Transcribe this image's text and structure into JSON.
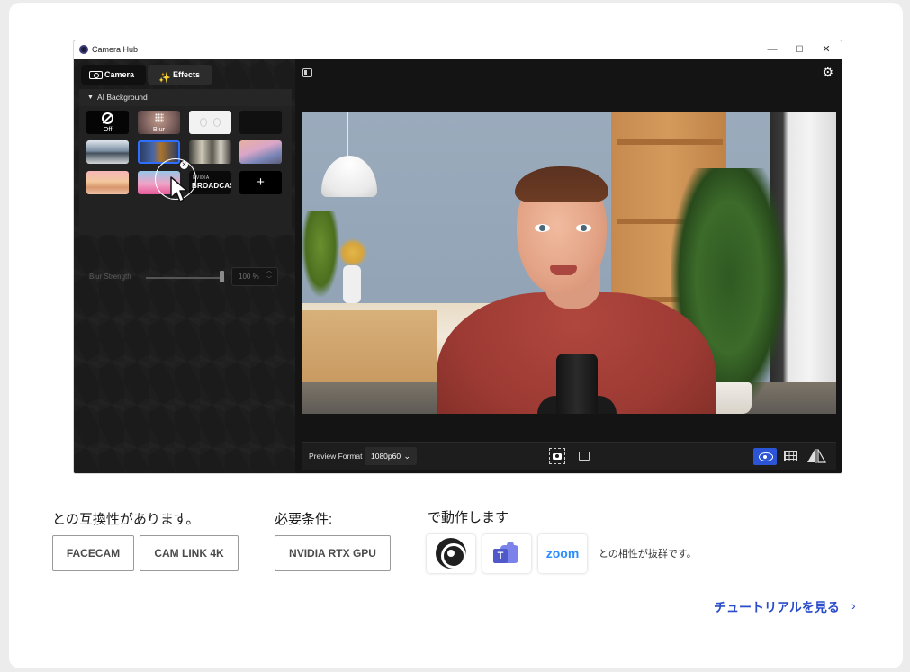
{
  "window": {
    "title": "Camera Hub",
    "controls": [
      "—",
      "☐",
      "✕"
    ]
  },
  "tabs": [
    {
      "label": "Camera",
      "icon": "camera-icon"
    },
    {
      "label": "Effects",
      "icon": "magic-wand-icon"
    }
  ],
  "ai_background": {
    "header": "AI Background",
    "tiles": [
      {
        "label": "Off"
      },
      {
        "label": "Blur"
      },
      {
        "label": ""
      },
      {
        "label": ""
      },
      {
        "label": ""
      },
      {
        "label": "",
        "selected": true
      },
      {
        "label": ""
      },
      {
        "label": ""
      },
      {
        "label": ""
      },
      {
        "label": ""
      },
      {
        "label": "NVIDIA BROADCAST",
        "logo_text": "NVIDIA",
        "text": "BROADCAST"
      },
      {
        "label": "+"
      }
    ],
    "blur_strength": {
      "label": "Blur Strength",
      "value": "100 %",
      "fraction": 1.0
    }
  },
  "toolbar": {
    "preview_format_label": "Preview Format",
    "preview_format_value": "1080p60",
    "active_view": "preview"
  },
  "compat": {
    "title": "との互換性があります。",
    "items": [
      "FACECAM",
      "CAM LINK 4K"
    ]
  },
  "requirements": {
    "title": "必要条件:",
    "items": [
      "NVIDIA RTX GPU"
    ]
  },
  "works_with": {
    "title": "で動作します",
    "apps": [
      "obs-studio-logo",
      "microsoft-teams-logo",
      "zoom-logo"
    ],
    "zoom_text": "zoom",
    "teams_letter": "T",
    "note": "との相性が抜群です。"
  },
  "tutorial_link": "チュートリアルを見る",
  "colors": {
    "accent": "#2b55d6",
    "link": "#2b4cc9",
    "app_bg": "#141414"
  }
}
